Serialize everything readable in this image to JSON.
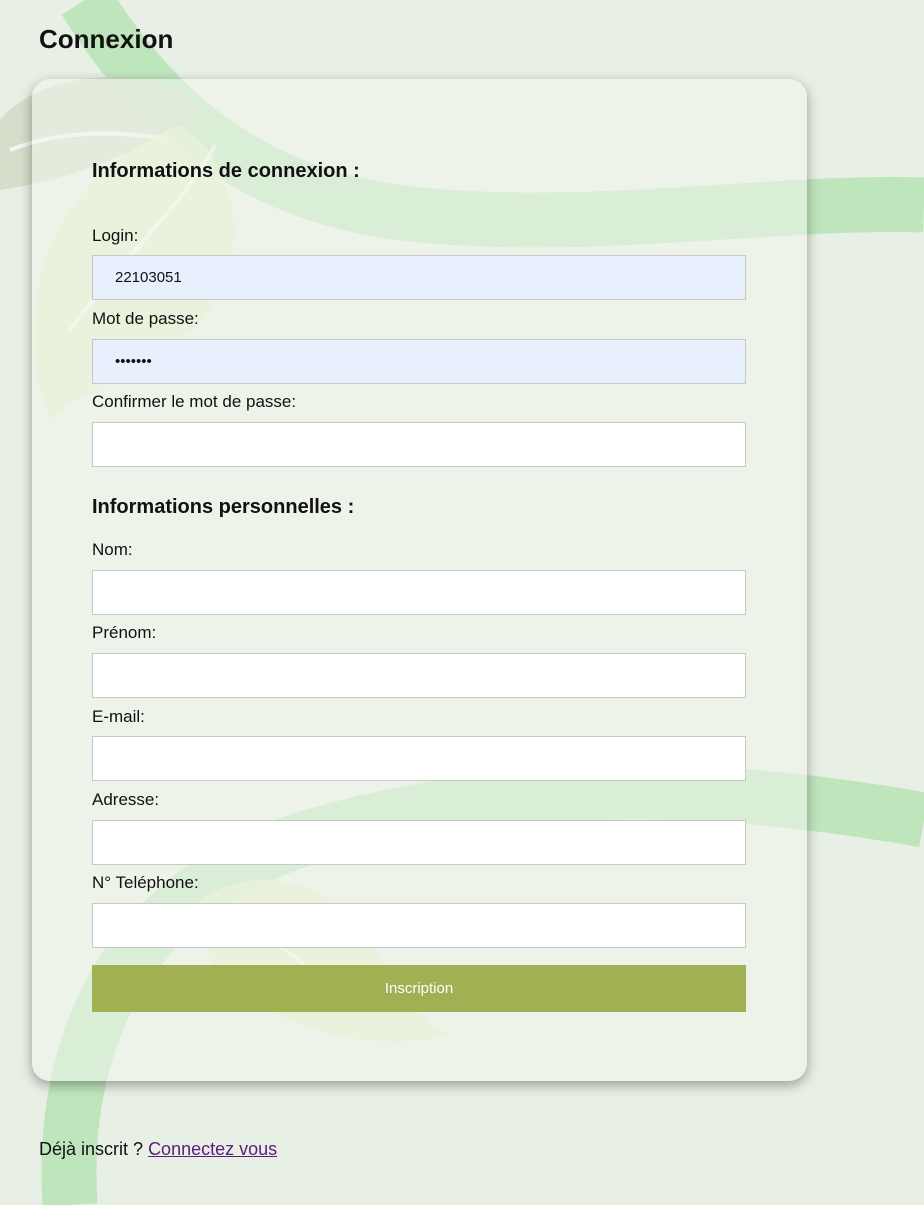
{
  "page": {
    "title": "Connexion"
  },
  "login_section": {
    "title": "Informations de connexion :",
    "login_label": "Login:",
    "login_value": "22103051",
    "password_label": "Mot de passe:",
    "password_value": "1234567",
    "confirm_label": "Confirmer le mot de passe:",
    "confirm_value": ""
  },
  "personal_section": {
    "title": "Informations personnelles :",
    "nom_label": "Nom:",
    "prenom_label": "Prénom:",
    "email_label": "E-mail:",
    "adresse_label": "Adresse:",
    "telephone_label": "N° Teléphone:"
  },
  "form": {
    "submit_label": "Inscription"
  },
  "footer": {
    "text": "Déjà inscrit ?",
    "link_label": "Connectez vous"
  },
  "colors": {
    "background": "#e8efe5",
    "button": "#a0b052",
    "autofill_field": "#e8f0fe",
    "link": "#5b1e7a"
  }
}
